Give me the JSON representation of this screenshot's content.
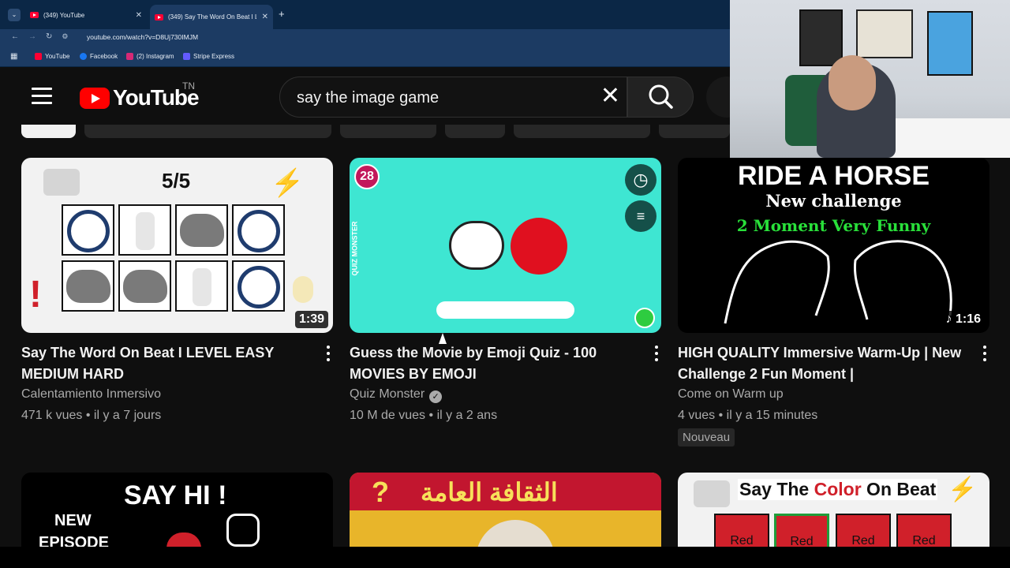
{
  "browser": {
    "tabs": [
      {
        "label": "(349) YouTube"
      },
      {
        "label": "(349) Say The Word On Beat I L"
      }
    ],
    "new_tab": "+",
    "url": "youtube.com/watch?v=D8Uj730IMJM",
    "bookmarks": [
      {
        "label": "YouTube",
        "color": "#ff0033"
      },
      {
        "label": "Facebook",
        "color": "#1877f2"
      },
      {
        "label": "(2) Instagram",
        "color": "#d62976"
      },
      {
        "label": "Stripe Express",
        "color": "#635bff"
      }
    ]
  },
  "youtube": {
    "logo_text": "YouTube",
    "country": "TN",
    "search_value": "say the image game"
  },
  "videos": [
    {
      "title": "Say The Word On Beat I LEVEL EASY MEDIUM HARD",
      "channel": "Calentamiento Inmersivo",
      "views": "471 k vues",
      "age": "il y a 7 jours",
      "duration": "1:39",
      "thumb_text": "5/5"
    },
    {
      "title": "Guess the Movie by Emoji Quiz - 100 MOVIES BY EMOJI",
      "channel": "Quiz Monster",
      "views": "10 M de vues",
      "age": "il y a 2 ans",
      "thumb_badge": "28",
      "thumb_side": "QUIZ MONSTER"
    },
    {
      "title": "HIGH QUALITY Immersive Warm-Up | New Challenge 2 Fun Moment |",
      "channel": "Come on Warm up",
      "views": "4 vues",
      "age": "il y a 15 minutes",
      "duration": "1:16",
      "badge": "Nouveau",
      "thumb_line1": "RIDE A HORSE",
      "thumb_line2": "New challenge",
      "thumb_line3": "2 Moment Very Funny"
    }
  ],
  "row2": [
    {
      "thumb_line1": "SAY HI !",
      "thumb_line2": "NEW",
      "thumb_line3": "EPISODE"
    },
    {
      "thumb_line1": "الثقافة العامة"
    },
    {
      "thumb_line1": "Say The ",
      "thumb_color": "Color",
      "thumb_line2": " On Beat",
      "cells": [
        "Red",
        "Red",
        "Red",
        "Red"
      ]
    }
  ],
  "meta_sep": "•"
}
